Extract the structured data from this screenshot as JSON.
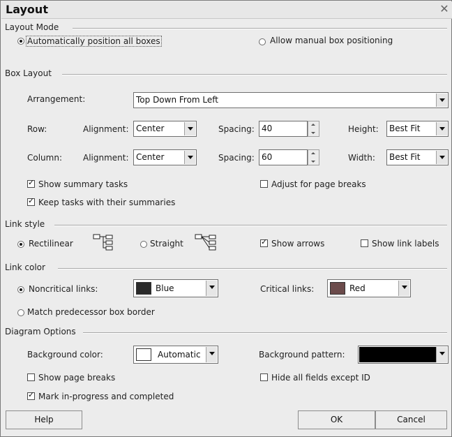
{
  "window": {
    "title": "Layout",
    "close_icon": "close-icon"
  },
  "layout_mode": {
    "heading": "Layout Mode",
    "auto_label": "Automatically position all boxes",
    "manual_label": "Allow manual box positioning",
    "selected": "auto"
  },
  "box_layout": {
    "heading": "Box Layout",
    "arrangement_label": "Arrangement:",
    "arrangement_value": "Top Down From Left",
    "row_label": "Row:",
    "row_alignment_label": "Alignment:",
    "row_alignment_value": "Center",
    "row_spacing_label": "Spacing:",
    "row_spacing_value": "40",
    "row_height_label": "Height:",
    "row_height_value": "Best Fit",
    "col_label": "Column:",
    "col_alignment_label": "Alignment:",
    "col_alignment_value": "Center",
    "col_spacing_label": "Spacing:",
    "col_spacing_value": "60",
    "col_width_label": "Width:",
    "col_width_value": "Best Fit",
    "show_summary_label": "Show summary tasks",
    "show_summary_checked": true,
    "adjust_breaks_label": "Adjust for page breaks",
    "adjust_breaks_checked": false,
    "keep_tasks_label": "Keep tasks with their summaries",
    "keep_tasks_checked": true
  },
  "link_style": {
    "heading": "Link style",
    "rectilinear_label": "Rectilinear",
    "straight_label": "Straight",
    "selected": "rectilinear",
    "show_arrows_label": "Show arrows",
    "show_arrows_checked": true,
    "show_link_labels_label": "Show link labels",
    "show_link_labels_checked": false
  },
  "link_color": {
    "heading": "Link color",
    "noncritical_label": "Noncritical links:",
    "noncritical_value": "Blue",
    "noncritical_color": "#2a2a2a",
    "critical_label": "Critical links:",
    "critical_value": "Red",
    "critical_color": "#6b4b4b",
    "match_border_label": "Match predecessor box border",
    "selected": "noncritical"
  },
  "diagram_options": {
    "heading": "Diagram Options",
    "bg_color_label": "Background color:",
    "bg_color_value": "Automatic",
    "bg_color_swatch": "#ffffff",
    "bg_pattern_label": "Background pattern:",
    "bg_pattern_color": "#000000",
    "show_breaks_label": "Show page breaks",
    "show_breaks_checked": false,
    "hide_fields_label": "Hide all fields except ID",
    "hide_fields_checked": false,
    "mark_progress_label": "Mark in-progress and completed",
    "mark_progress_checked": true
  },
  "buttons": {
    "help": "Help",
    "ok": "OK",
    "cancel": "Cancel"
  }
}
